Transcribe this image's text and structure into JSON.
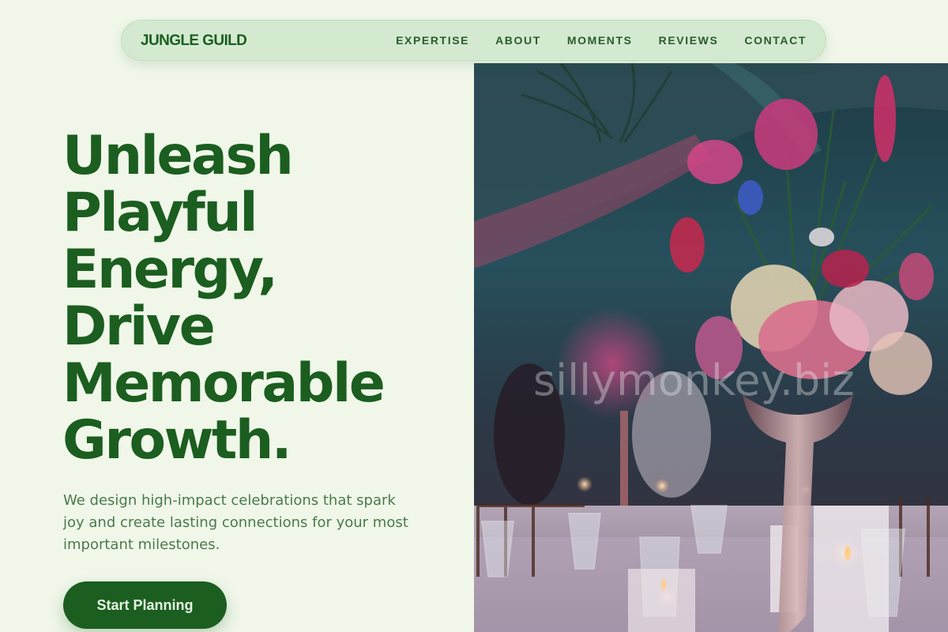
{
  "nav": {
    "brand": "JUNGLE GUILD",
    "links": [
      "EXPERTISE",
      "ABOUT",
      "MOMENTS",
      "REVIEWS",
      "CONTACT"
    ]
  },
  "hero": {
    "headline_lines": [
      "Unleash",
      "Playful",
      "Energy,",
      "Drive",
      "Memorable",
      "Growth."
    ],
    "subtext": "We design high-impact celebrations that spark joy and create lasting connections for your most important milestones.",
    "cta_label": "Start Planning",
    "image_watermark": "sillymonkey.biz"
  },
  "colors": {
    "background": "#f0f7e9",
    "nav_pill": "#d3ead0",
    "brand_green": "#1b5e20",
    "body_text": "#4a7a4c"
  }
}
